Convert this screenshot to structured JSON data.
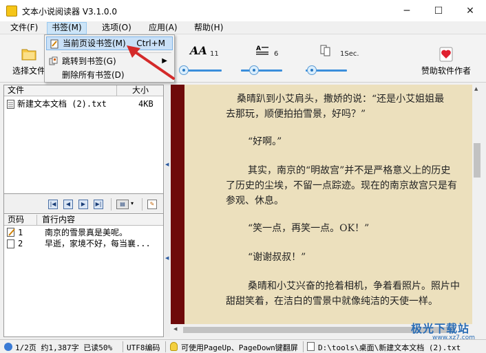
{
  "window": {
    "title": "文本小说阅读器 V3.1.0.0",
    "minimize": "─",
    "maximize": "☐",
    "close": "✕"
  },
  "menubar": {
    "items": [
      "文件(F)",
      "书签(M)",
      "选项(O)",
      "应用(A)",
      "帮助(H)"
    ]
  },
  "toolbar": {
    "open_file_label": "选择文件",
    "font_size_value": "11",
    "line_spacing_value": "6",
    "scroll_interval_value": "1Sec.",
    "sponsor_label": "赞助软件作者",
    "font_icon_text": "AA"
  },
  "bookmark_menu": {
    "items": [
      {
        "label": "当前页设书签(M)",
        "shortcut": "Ctrl+M"
      },
      {
        "label": "跳转到书签(G)",
        "shortcut": ""
      },
      {
        "label": "删除所有书签(D)",
        "shortcut": ""
      }
    ]
  },
  "file_list": {
    "columns": [
      "文件",
      "大小"
    ],
    "rows": [
      {
        "name": "新建文本文档 (2).txt",
        "size": "4KB"
      }
    ]
  },
  "bookmark_list": {
    "columns": [
      "页码",
      "首行内容"
    ],
    "rows": [
      {
        "page": "1",
        "text": "南京的雪景真是美呢。"
      },
      {
        "page": "2",
        "text": "早逝，家境不好，每当襄..."
      }
    ]
  },
  "reader": {
    "lines": [
      "桑晴趴到小艾肩头，撒娇的说：“还是小艾姐姐最",
      "去那玩，顺便拍拍雪景，好吗？”",
      "“好啊。”",
      "其实，南京的“明故宫”并不是严格意义上的历史",
      "了历史的尘埃，不留一点踪迹。现在的南京故宫只是有",
      "参观、休息。",
      "“笑一点，再笑一点。OK！”",
      "“谢谢叔叔！”",
      "桑晴和小艾兴奋的抢着相机，争着看照片。照片中",
      "甜甜笑着，在洁白的雪景中就像纯洁的天使一样。"
    ]
  },
  "statusbar": {
    "page_info": "1/2页 约1,387字 已读50%",
    "encoding": "UTF8编码",
    "hint": "可使用PageUp、PageDown键翻屏",
    "path": "D:\\tools\\桌面\\新建文本文档 (2).txt"
  },
  "watermark": {
    "text": "极光下载站",
    "sub": "www.xz7.com"
  },
  "colors": {
    "reader_bg": "#ece0bd",
    "spine": "#6e0a0a",
    "accent": "#3a8edb",
    "arrow": "#d42a2a"
  }
}
